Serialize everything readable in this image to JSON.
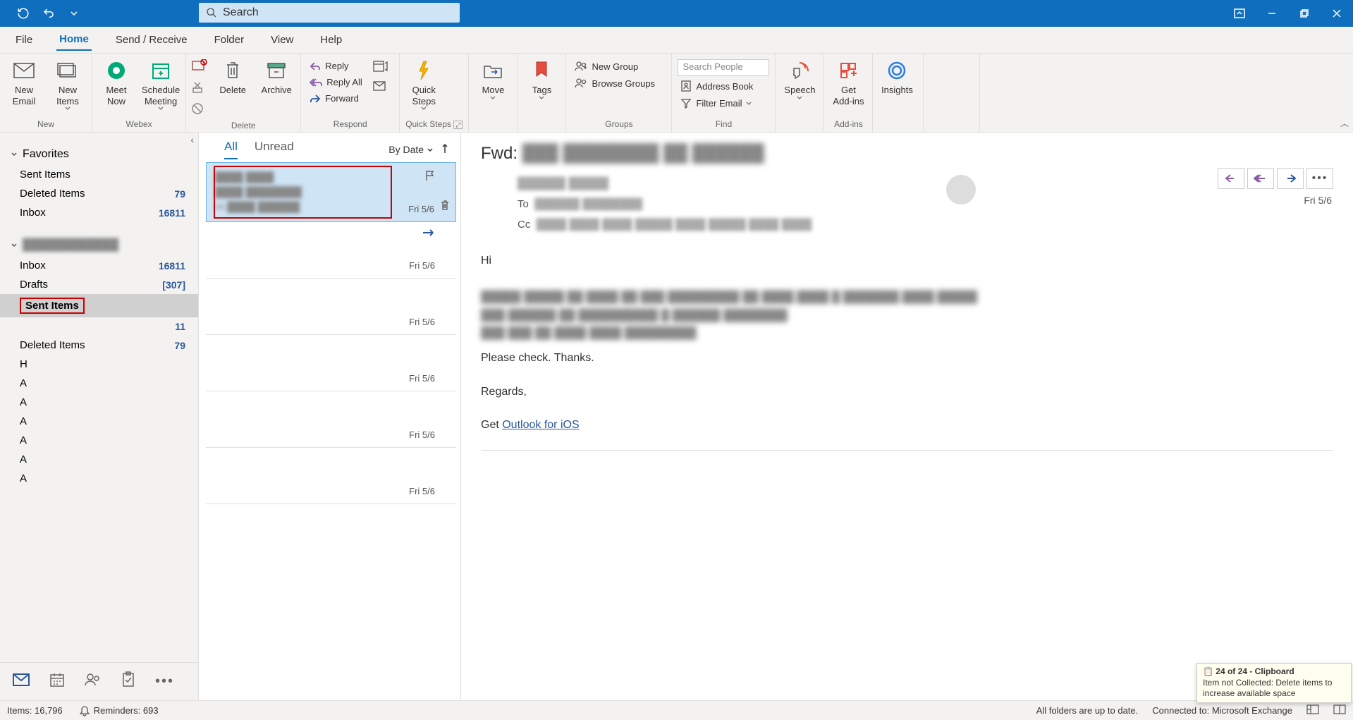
{
  "titlebar": {
    "search_placeholder": "Search"
  },
  "menu": {
    "file": "File",
    "home": "Home",
    "send_receive": "Send / Receive",
    "folder": "Folder",
    "view": "View",
    "help": "Help"
  },
  "ribbon": {
    "new_email": "New\nEmail",
    "new_items": "New\nItems",
    "meet_now": "Meet\nNow",
    "schedule_meeting": "Schedule\nMeeting",
    "delete": "Delete",
    "archive": "Archive",
    "reply": "Reply",
    "reply_all": "Reply All",
    "forward": "Forward",
    "quick_steps": "Quick\nSteps",
    "move": "Move",
    "tags": "Tags",
    "new_group": "New Group",
    "browse_groups": "Browse Groups",
    "search_people_ph": "Search People",
    "address_book": "Address Book",
    "filter_email": "Filter Email",
    "speech": "Speech",
    "get_addins": "Get\nAdd-ins",
    "insights": "Insights",
    "grp_new": "New",
    "grp_webex": "Webex",
    "grp_delete": "Delete",
    "grp_respond": "Respond",
    "grp_quick": "Quick Steps",
    "grp_groups": "Groups",
    "grp_find": "Find",
    "grp_addins": "Add-ins"
  },
  "nav": {
    "favorites": "Favorites",
    "fav_items": [
      {
        "label": "Sent Items",
        "count": ""
      },
      {
        "label": "Deleted Items",
        "count": "79"
      },
      {
        "label": "Inbox",
        "count": "16811"
      }
    ],
    "account_blur": "████████████",
    "folders": [
      {
        "label": "Inbox",
        "count": "16811"
      },
      {
        "label": "Drafts",
        "count": "[307]"
      },
      {
        "label": "Sent Items",
        "count": "",
        "selected": true,
        "redbox": true
      },
      {
        "label": "",
        "count": "11"
      },
      {
        "label": "Deleted Items",
        "count": "79"
      },
      {
        "label": "H",
        "count": ""
      },
      {
        "label": "A",
        "count": ""
      },
      {
        "label": "A",
        "count": ""
      },
      {
        "label": "A",
        "count": ""
      },
      {
        "label": "A",
        "count": ""
      },
      {
        "label": "A",
        "count": ""
      },
      {
        "label": "A",
        "count": ""
      }
    ]
  },
  "msglist": {
    "tab_all": "All",
    "tab_unread": "Unread",
    "sort_label": "By Date",
    "items": [
      {
        "date": "Fri 5/6",
        "selected": true,
        "redbox": true,
        "flag": true,
        "delete": true,
        "l1": "████ ████",
        "l2": "████ ████████",
        "l3": "Hi ████ ██████"
      },
      {
        "date": "Fri 5/6",
        "forward": true
      },
      {
        "date": "Fri 5/6"
      },
      {
        "date": "Fri 5/6"
      },
      {
        "date": "Fri 5/6"
      },
      {
        "date": "Fri 5/6"
      }
    ]
  },
  "reading": {
    "subject_prefix": "Fwd:",
    "subject_blur": "███ ████████   ██ ██████",
    "from_blur": "██████ █████",
    "to_label": "To",
    "to_blur": "██████ ████████",
    "cc_label": "Cc",
    "cc_blur": "████ ████ ████ █████ ████ █████ ████ ████",
    "date": "Fri 5/6",
    "body_hi": "Hi",
    "body_blur": "█████ █████ ██ ████ ██ ███ █████████ ██ ████ ████ █ ███████ ████ █████\n███ ██████ ██ ██████████   █ ██████ ████████\n███ ███ ██ ████ ████ █████████",
    "body_check": "Please check. Thanks.",
    "body_regards": "Regards,",
    "body_get": "Get ",
    "body_link": "Outlook for iOS"
  },
  "status": {
    "items": "Items: 16,796",
    "reminders": "Reminders: 693",
    "folders": "All folders are up to date.",
    "connected": "Connected to: Microsoft Exchange",
    "clip_title": "24 of 24 - Clipboard",
    "clip_body": "Item not Collected: Delete items to increase available space"
  }
}
